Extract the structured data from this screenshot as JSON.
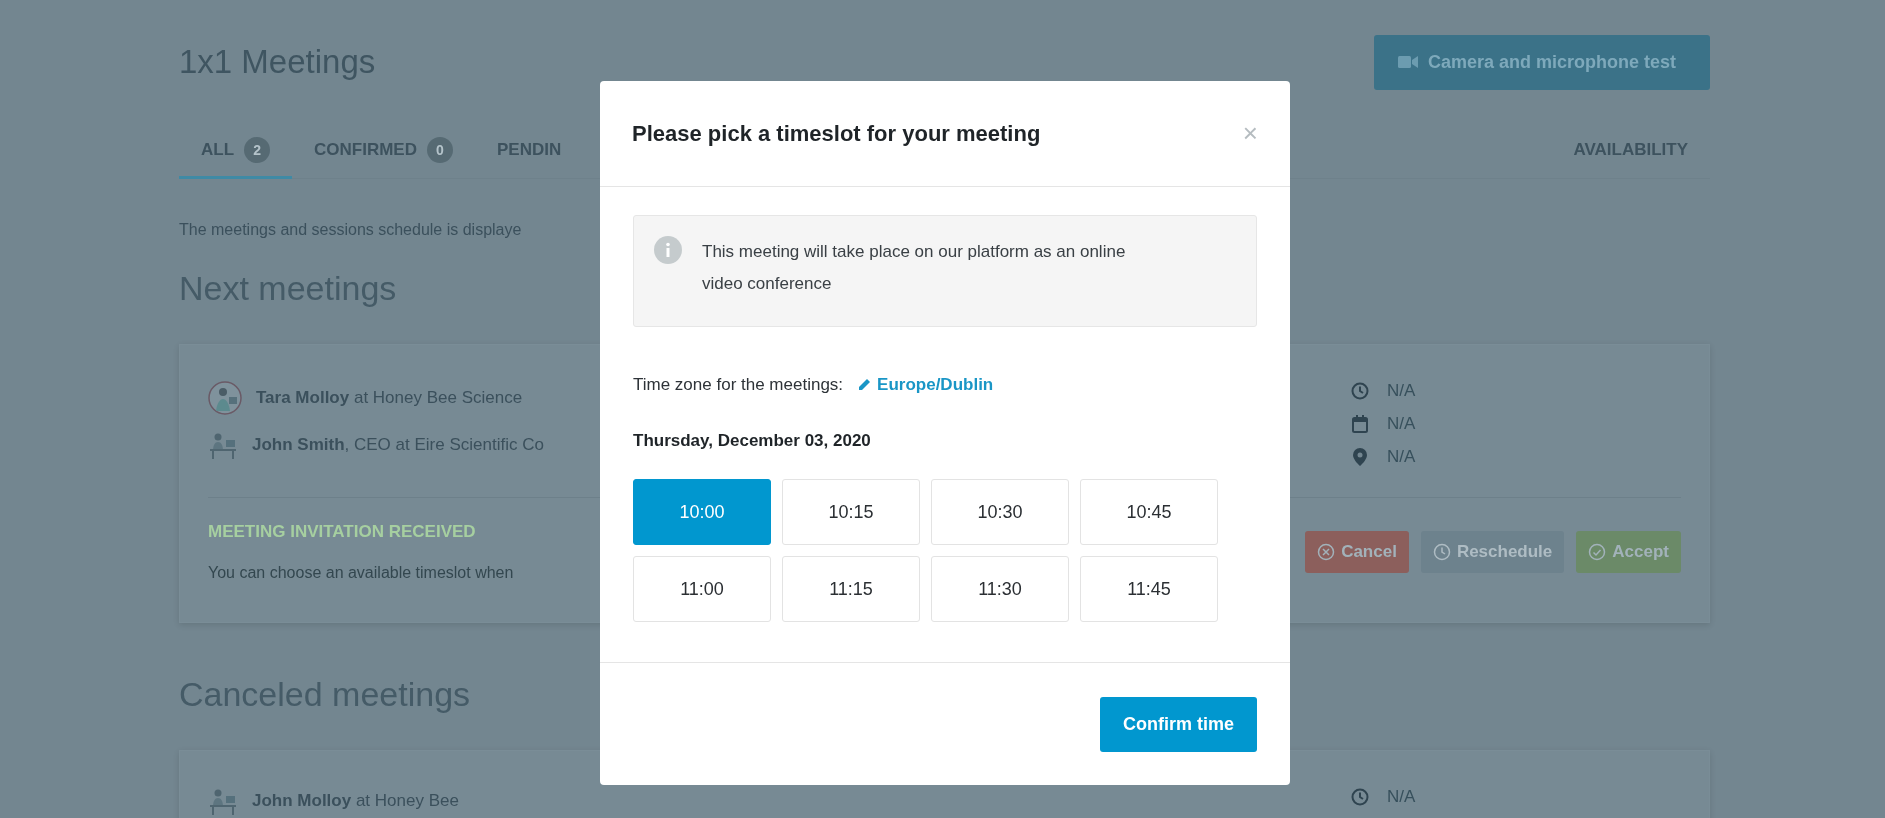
{
  "page": {
    "title": "1x1 Meetings",
    "camera_button": "Camera and microphone test",
    "tabs": [
      {
        "label": "ALL",
        "count": "2",
        "selected": true
      },
      {
        "label": "CONFIRMED",
        "count": "0",
        "selected": false
      },
      {
        "label": "PENDIN",
        "selected": false
      }
    ],
    "availability_tab": {
      "label": "AVAILABILITY",
      "selected": false
    },
    "notice": "The meetings and sessions schedule is displaye",
    "sections": [
      {
        "title": "Next meetings",
        "meetings": [
          {
            "participants": [
              {
                "text": "**Tara Molloy** at Honey Bee Science",
                "kind": "round"
              },
              {
                "text": "**John Smith**, CEO at Eire Scientific Co",
                "kind": "desk"
              }
            ],
            "info": [
              {
                "kind": "time",
                "text": "N/A"
              },
              {
                "kind": "date",
                "text": "N/A"
              },
              {
                "kind": "location",
                "text": "N/A"
              }
            ],
            "status": "MEETING INVITATION RECEIVED",
            "message": "You can choose an available timeslot when",
            "actions": [
              {
                "kind": "cancel",
                "label": "Cancel",
                "disabled": false
              },
              {
                "kind": "reschedule",
                "label": "Reschedule",
                "disabled": true
              },
              {
                "kind": "accept",
                "label": "Accept",
                "disabled": false
              }
            ]
          }
        ]
      },
      {
        "title": "Canceled meetings",
        "meetings": [
          {
            "participants": [
              {
                "text": "**John Molloy** at Honey Bee",
                "kind": "desk"
              }
            ],
            "info": [
              {
                "kind": "time",
                "text": "N/A"
              }
            ]
          }
        ]
      }
    ]
  },
  "modal": {
    "title": "Please pick a timeslot for your meeting",
    "close": "×",
    "info": "This meeting will take place on our platform as an online video conference",
    "timezone_label": "Time zone for the meetings:",
    "timezone": "Europe/Dublin",
    "date": "Thursday, December 03, 2020",
    "slots": [
      {
        "time": "10:00",
        "selected": true
      },
      {
        "time": "10:15",
        "selected": false
      },
      {
        "time": "10:30",
        "selected": false
      },
      {
        "time": "10:45",
        "selected": false
      },
      {
        "time": "11:00",
        "selected": false
      },
      {
        "time": "11:15",
        "selected": false
      },
      {
        "time": "11:30",
        "selected": false
      },
      {
        "time": "11:45",
        "selected": false
      }
    ],
    "confirm_button": "Confirm time"
  }
}
